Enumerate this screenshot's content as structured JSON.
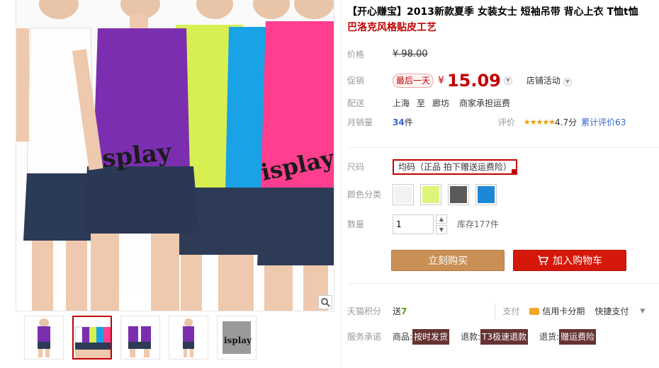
{
  "product": {
    "title_line1": "【开心赚宝】2013新款夏季 女装女士 短袖吊带 背心上衣 T恤t恤",
    "title_line2": "巴洛克风格贴皮工艺"
  },
  "price": {
    "label": "价格",
    "value": "¥ 98.00"
  },
  "promo": {
    "label": "促销",
    "tag": "最后一天",
    "currency": "¥",
    "price": "15.09",
    "shop_activity": "店铺活动"
  },
  "shipping": {
    "label": "配送",
    "from": "上海",
    "to_word": "至",
    "to": "廊坊",
    "cost": "商家承担运费"
  },
  "sales": {
    "label": "月销量",
    "count": "34",
    "unit": "件",
    "review_label": "评价",
    "stars": "★★★★★",
    "score": "4.7分",
    "total_reviews": "累计评价63"
  },
  "size": {
    "label": "尺码",
    "selected": "均码（正品 拍下赠送运费险）"
  },
  "color": {
    "label": "颜色分类",
    "swatches": [
      "#f2f2f2",
      "#dcf57a",
      "#5a5a5a",
      "#1e88d8"
    ]
  },
  "quantity": {
    "label": "数量",
    "value": "1",
    "up": "▲",
    "down": "▼",
    "stock": "库存177件"
  },
  "buttons": {
    "buy_now": "立刻购买",
    "add_to_cart": "加入购物车"
  },
  "points": {
    "label": "天猫积分",
    "prefix": "送",
    "value": "7",
    "pay_label": "支付",
    "card_pay": "信用卡分期",
    "quick_pay": "快捷支付"
  },
  "service": {
    "label": "服务承诺",
    "goods_prefix": "商品:",
    "goods_badge": "按时发货",
    "return_prefix": "退款:",
    "return_badge": "T3极速退款",
    "exchange_prefix": "退货:",
    "exchange_badge": "赠运费险"
  },
  "icons": {
    "zoom": "search-icon",
    "cart": "cart-icon",
    "dropdown": "chevron-down-icon"
  },
  "shirt_colors": [
    "#ffffff",
    "#7b2fb0",
    "#d8ef52",
    "#1aa2e6",
    "#ff3e90"
  ],
  "accent": "#c40000"
}
